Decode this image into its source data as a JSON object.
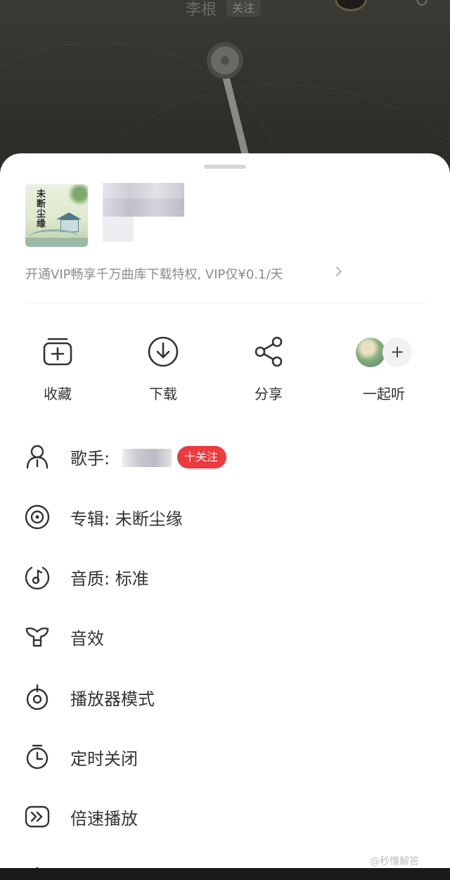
{
  "background": {
    "artist_name": "李根",
    "follow_label": "关注"
  },
  "song": {
    "cover_title": "未断尘缘",
    "vip_promo": "开通VIP畅享千万曲库下载特权, VIP仅¥0.1/天"
  },
  "actions": [
    {
      "label": "收藏",
      "icon": "collect-icon"
    },
    {
      "label": "下载",
      "icon": "download-icon"
    },
    {
      "label": "分享",
      "icon": "share-icon"
    },
    {
      "label": "一起听",
      "icon": "listen-together-icon"
    }
  ],
  "together_plus": "+",
  "menu": {
    "singer_label": "歌手:",
    "follow_badge": "十关注",
    "album": "专辑: 未断尘缘",
    "quality": "音质: 标准",
    "effects": "音效",
    "player_mode": "播放器模式",
    "timer": "定时关闭",
    "speed": "倍速播放"
  },
  "watermark": "@秒懂解答"
}
